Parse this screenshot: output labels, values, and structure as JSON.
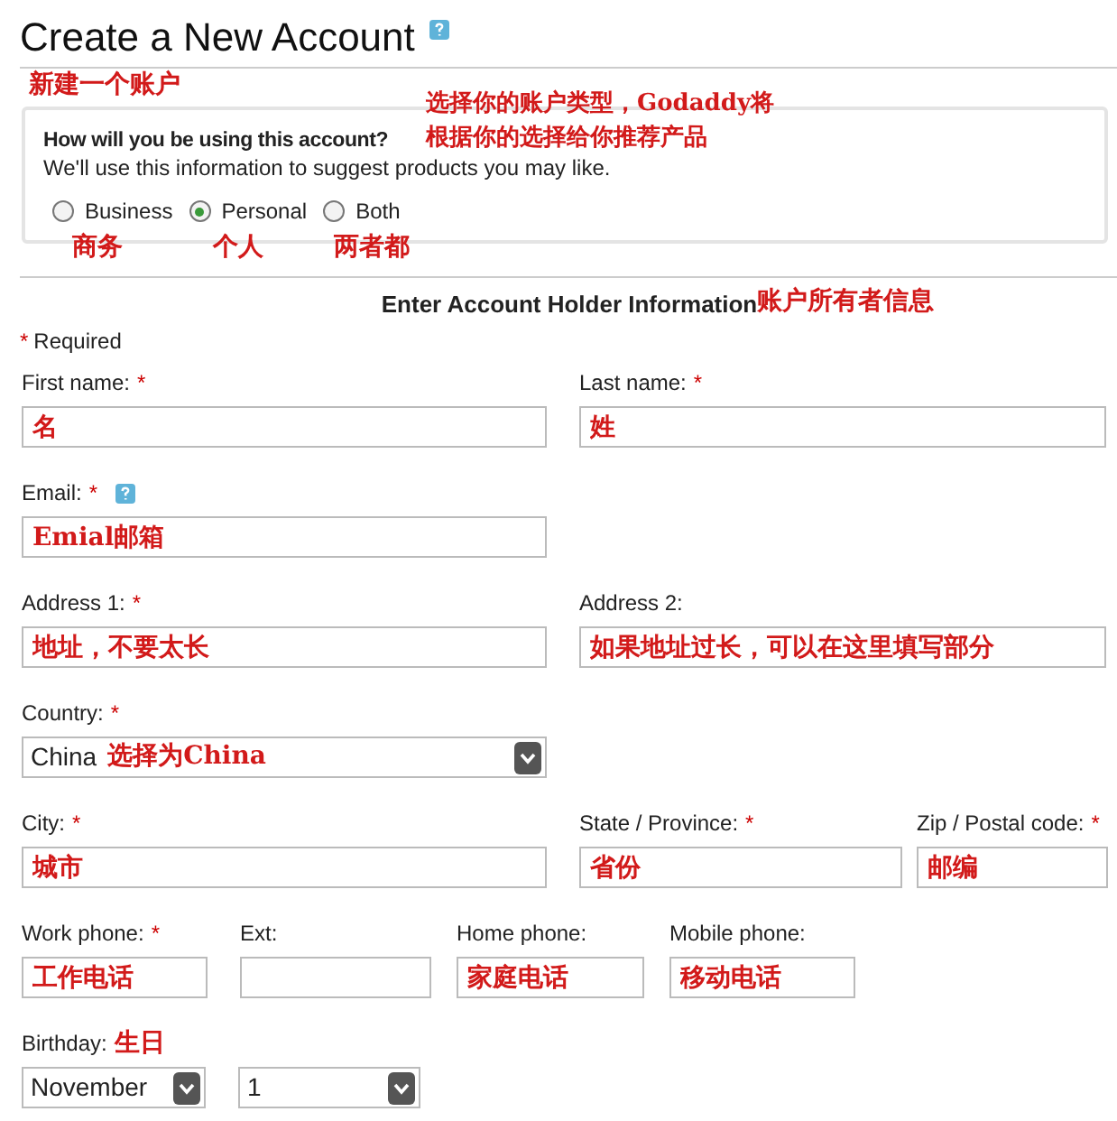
{
  "title": "Create a New Account",
  "title_note": "新建一个账户",
  "usage": {
    "question": "How will you be using this account?",
    "hint": "We'll use this information to suggest products you may like.",
    "note": [
      "选择你的账户类型，Godaddy将",
      "根据你的选择给你推荐产品"
    ],
    "options": [
      {
        "label": "Business",
        "selected": false,
        "note": "商务"
      },
      {
        "label": "Personal",
        "selected": true,
        "note": "个人"
      },
      {
        "label": "Both",
        "selected": false,
        "note": "两者都"
      }
    ]
  },
  "section": {
    "title": "Enter Account Holder Information",
    "note": "账户所有者信息"
  },
  "required": {
    "mark": "*",
    "label": "Required"
  },
  "rows": [
    [
      {
        "kind": "text",
        "label": "First name:",
        "mark": "*",
        "value": "名"
      },
      {
        "kind": "text",
        "label": "Last name:",
        "mark": "*",
        "value": "姓"
      }
    ],
    [
      {
        "kind": "text",
        "label": "Email:",
        "mark": "*",
        "help": true,
        "value": "Emial邮箱"
      }
    ],
    [
      {
        "kind": "text",
        "label": "Address 1:",
        "mark": "*",
        "value": "地址，不要太长"
      },
      {
        "kind": "text",
        "label": "Address 2:",
        "value": "如果地址过长，可以在这里填写部分"
      }
    ],
    [
      {
        "kind": "select",
        "label": "Country:",
        "mark": "*",
        "value": "China",
        "note": "选择为China"
      }
    ],
    [
      {
        "kind": "text",
        "label": "City:",
        "mark": "*",
        "value": "城市"
      },
      {
        "kind": "text",
        "label": "State / Province:",
        "mark": "*",
        "value": "省份"
      },
      {
        "kind": "text",
        "label": "Zip / Postal code:",
        "mark": "*",
        "value": "邮编"
      }
    ],
    [
      {
        "kind": "text",
        "label": "Work phone:",
        "mark": "*",
        "value": "工作电话"
      },
      {
        "kind": "text",
        "label": "Ext:"
      },
      {
        "kind": "text",
        "label": "Home phone:",
        "value": "家庭电话"
      },
      {
        "kind": "text",
        "label": "Mobile phone:",
        "value": "移动电话"
      }
    ],
    [
      {
        "kind": "select",
        "label": "Birthday:",
        "label_note": "生日",
        "value": "November"
      },
      {
        "kind": "select",
        "value": "1"
      }
    ]
  ]
}
